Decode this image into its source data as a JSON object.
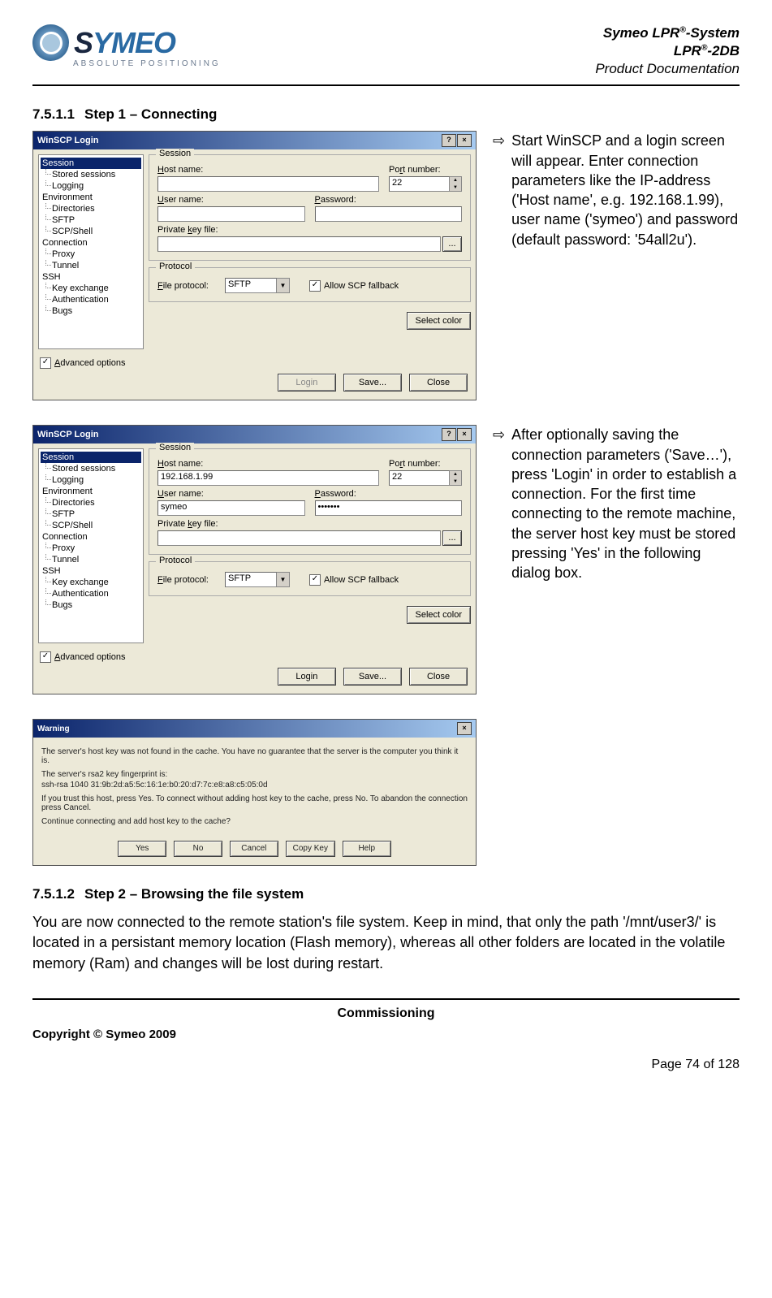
{
  "header": {
    "logo_text_1": "S",
    "logo_text_2": "YMEO",
    "logo_sub": "ABSOLUTE POSITIONING",
    "doc_line1_pre": "Symeo LPR",
    "doc_line1_post": "-System",
    "doc_line2_pre": "LPR",
    "doc_line2_post": "-2DB",
    "doc_line3": "Product Documentation",
    "sup": "®"
  },
  "section1": {
    "num": "7.5.1.1",
    "title": "Step 1 – Connecting"
  },
  "dialog": {
    "title": "WinSCP Login",
    "help_btn": "?",
    "close_btn": "×",
    "tree": {
      "session": "Session",
      "stored": "Stored sessions",
      "logging": "Logging",
      "env": "Environment",
      "dirs": "Directories",
      "sftp": "SFTP",
      "scp": "SCP/Shell",
      "conn": "Connection",
      "proxy": "Proxy",
      "tunnel": "Tunnel",
      "ssh": "SSH",
      "keyex": "Key exchange",
      "auth": "Authentication",
      "bugs": "Bugs"
    },
    "group_session": "Session",
    "host_label_u": "H",
    "host_label": "ost name:",
    "port_label_pre": "Po",
    "port_label_u": "r",
    "port_label_post": "t number:",
    "port_value": "22",
    "user_label_u": "U",
    "user_label": "ser name:",
    "pass_label_u": "P",
    "pass_label": "assword:",
    "key_label_pre": "Private ",
    "key_label_u": "k",
    "key_label_post": "ey file:",
    "browse": "...",
    "group_proto": "Protocol",
    "file_proto_u": "F",
    "file_proto": "ile protocol:",
    "sftp_val": "SFTP",
    "allow_scp": "Allow SCP fallback",
    "select_color": "Select color",
    "adv_u": "A",
    "adv": "dvanced options",
    "login": "Login",
    "save": "Save...",
    "close": "Close",
    "host_val2": "192.168.1.99",
    "user_val2": "symeo",
    "pass_val2": "•••••••"
  },
  "note1": "Start WinSCP and a login screen will appear. Enter connection parameters like the IP-address ('Host name', e.g. 192.168.1.99), user name ('symeo') and password (default password: '54all2u').",
  "note2": "After optionally saving the connection parameters ('Save…'), press 'Login' in order to establish a connection. For the first time connecting to the remote machine, the server host key must be stored pressing 'Yes' in the following dialog box.",
  "arrow": "⇨",
  "warning": {
    "title": "Warning",
    "line1": "The server's host key was not found in the cache. You have no guarantee that the server is the computer you think it is.",
    "line2": "The server's rsa2 key fingerprint is:",
    "line3": "ssh-rsa 1040 31:9b:2d:a5:5c:16:1e:b0:20:d7:7c:e8:a8:c5:05:0d",
    "line4": "If you trust this host, press Yes. To connect without adding host key to the cache, press No. To abandon the connection press Cancel.",
    "line5": "Continue connecting and add host key to the cache?",
    "yes": "Yes",
    "no": "No",
    "cancel": "Cancel",
    "copy": "Copy Key",
    "help": "Help"
  },
  "section2": {
    "num": "7.5.1.2",
    "title": "Step 2 – Browsing the file system"
  },
  "body2": "You are now connected to the remote station's file system. Keep in mind, that only the path '/mnt/user3/' is located in a persistant memory location (Flash memory), whereas all other folders are located in the volatile memory (Ram) and changes will be lost during restart.",
  "footer": {
    "center": "Commissioning",
    "copyright": "Copyright © Symeo 2009",
    "page": "Page 74 of 128"
  }
}
